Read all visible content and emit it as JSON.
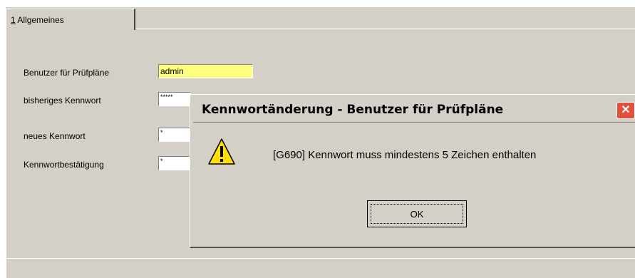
{
  "tab": {
    "number": "1",
    "label": " Allgemeines"
  },
  "form": {
    "user_label": "Benutzer für Prüfpläne",
    "user_value": "admin",
    "old_pw_label": "bisheriges Kennwort",
    "old_pw_value": "*****",
    "new_pw_label": "neues Kennwort",
    "new_pw_value": "*",
    "confirm_label": "Kennwortbestätigung",
    "confirm_value": "*"
  },
  "dialog": {
    "title": "Kennwortänderung - Benutzer für Prüfpläne",
    "close_symbol": "✕",
    "icon": "warning-icon",
    "message": "[G690] Kennwort muss mindestens 5 Zeichen enthalten",
    "ok_label": "OK"
  },
  "colors": {
    "window_bg": "#d4d0c8",
    "field_highlight": "#ffff80",
    "close_button": "#e0503a",
    "warning_yellow": "#ffe000"
  }
}
